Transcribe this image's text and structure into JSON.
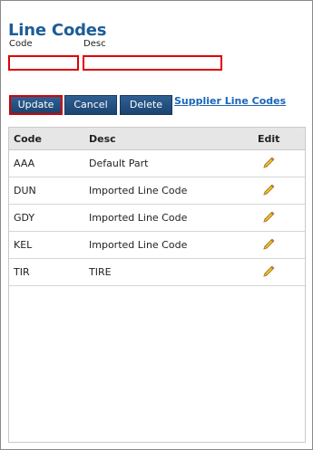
{
  "page": {
    "title": "Line Codes"
  },
  "form": {
    "code_label": "Code",
    "desc_label": "Desc",
    "code_value": "",
    "desc_value": ""
  },
  "buttons": {
    "update": "Update",
    "cancel": "Cancel",
    "delete": "Delete"
  },
  "links": {
    "supplier_line_codes": "Supplier Line Codes"
  },
  "table": {
    "headers": {
      "code": "Code",
      "desc": "Desc",
      "edit": "Edit"
    },
    "rows": [
      {
        "code": "AAA",
        "desc": "Default Part",
        "edit_icon": "pencil-icon"
      },
      {
        "code": "DUN",
        "desc": "Imported Line Code",
        "edit_icon": "pencil-icon"
      },
      {
        "code": "GDY",
        "desc": "Imported Line Code",
        "edit_icon": "pencil-icon"
      },
      {
        "code": "KEL",
        "desc": "Imported Line Code",
        "edit_icon": "pencil-icon"
      },
      {
        "code": "TIR",
        "desc": "TIRE",
        "edit_icon": "pencil-icon"
      }
    ]
  },
  "colors": {
    "title": "#1e5c97",
    "button": "#1b4472",
    "highlight_border": "#e00000",
    "link": "#1b65b8",
    "header_bg": "#e6e6e6"
  }
}
